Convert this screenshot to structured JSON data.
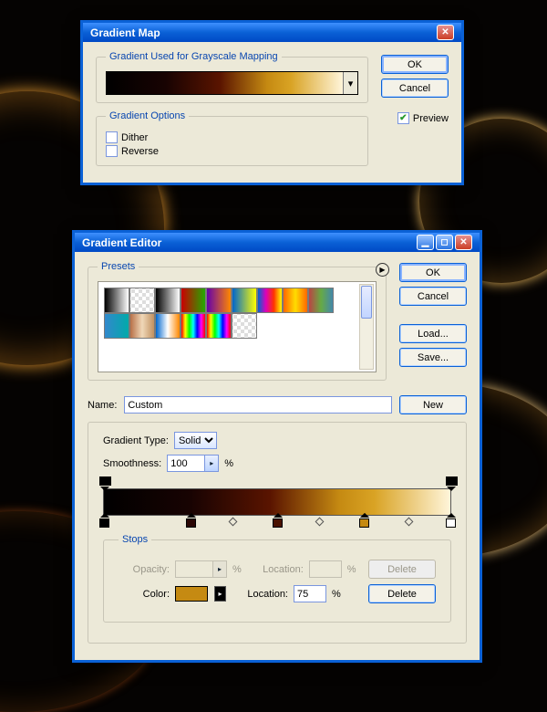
{
  "gradient_map": {
    "title": "Gradient Map",
    "sections": {
      "mapping": "Gradient Used for Grayscale Mapping",
      "options": "Gradient Options"
    },
    "buttons": {
      "ok": "OK",
      "cancel": "Cancel"
    },
    "preview": {
      "label": "Preview",
      "checked": true
    },
    "options": {
      "dither": {
        "label": "Dither",
        "checked": false
      },
      "reverse": {
        "label": "Reverse",
        "checked": false
      }
    }
  },
  "gradient_editor": {
    "title": "Gradient Editor",
    "presets_label": "Presets",
    "buttons": {
      "ok": "OK",
      "cancel": "Cancel",
      "load": "Load...",
      "save": "Save...",
      "new": "New"
    },
    "name_label": "Name:",
    "name_value": "Custom",
    "type_label": "Gradient Type:",
    "type_value": "Solid",
    "smoothness_label": "Smoothness:",
    "smoothness_value": "100",
    "percent": "%",
    "preset_swatches": [
      "linear-gradient(90deg,#000,#fff)",
      "repeating-conic-gradient(#fff 0 25%,#ddd 0 50%) 50%/8px 8px",
      "linear-gradient(90deg,#000,#fff)",
      "linear-gradient(90deg,#c00,#2a0)",
      "linear-gradient(90deg,#60a,#f80)",
      "linear-gradient(90deg,#06c,#ff0)",
      "linear-gradient(90deg,#06c,#d0b,#f30,#ff0)",
      "linear-gradient(90deg,#f60,#fd0,#f60)",
      "linear-gradient(90deg,#b44,#6a4,#48a)",
      "linear-gradient(90deg,#38c,#0aa)",
      "linear-gradient(90deg,#b87048,#f0d8b8,#c09060)",
      "linear-gradient(90deg,#06c,#fff,#f80)",
      "linear-gradient(90deg,#f00,#ff0,#0f0,#0ff,#00f,#f0f,#f00)",
      "linear-gradient(90deg,#f00,#ff0,#0f0,#0ff,#00f,#f0f,#f00)",
      "repeating-conic-gradient(#fff 0 25%,#ddd 0 50%) 50%/8px 8px"
    ],
    "color_stops": [
      {
        "pos": 0,
        "color": "#000000"
      },
      {
        "pos": 25,
        "color": "#2a0604"
      },
      {
        "pos": 50,
        "color": "#4a1200"
      },
      {
        "pos": 75,
        "color": "#c58a12",
        "selected": true
      },
      {
        "pos": 100,
        "color": "#ffffff"
      }
    ],
    "opacity_stops": [
      {
        "pos": 0
      },
      {
        "pos": 100
      }
    ],
    "midpoints": [
      37,
      62,
      88
    ],
    "stops": {
      "legend": "Stops",
      "opacity_label": "Opacity:",
      "location_label": "Location:",
      "color_label": "Color:",
      "delete": "Delete",
      "color_value": "#c58a12",
      "location_value": "75"
    }
  }
}
